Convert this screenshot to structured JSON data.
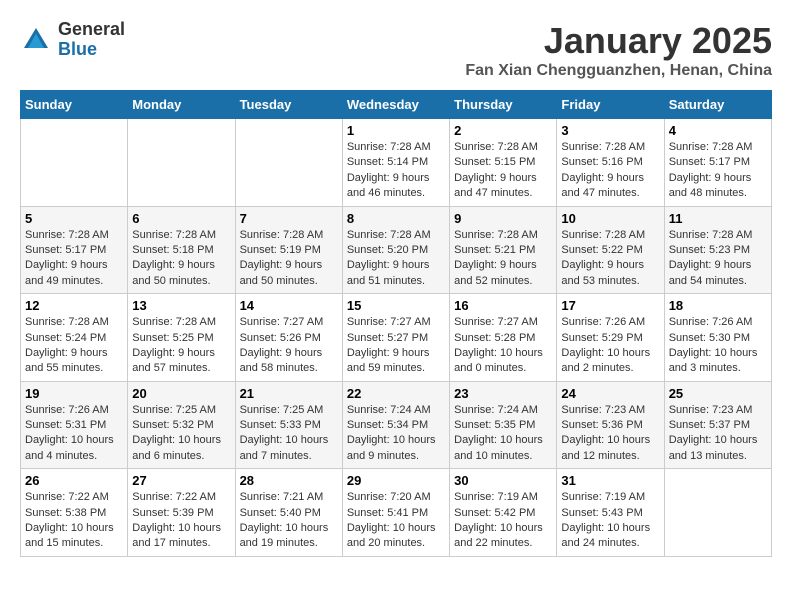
{
  "header": {
    "logo_general": "General",
    "logo_blue": "Blue",
    "title": "January 2025",
    "subtitle": "Fan Xian Chengguanzhen, Henan, China"
  },
  "days_of_week": [
    "Sunday",
    "Monday",
    "Tuesday",
    "Wednesday",
    "Thursday",
    "Friday",
    "Saturday"
  ],
  "weeks": [
    {
      "days": [
        {
          "number": "",
          "content": ""
        },
        {
          "number": "",
          "content": ""
        },
        {
          "number": "",
          "content": ""
        },
        {
          "number": "1",
          "content": "Sunrise: 7:28 AM\nSunset: 5:14 PM\nDaylight: 9 hours\nand 46 minutes."
        },
        {
          "number": "2",
          "content": "Sunrise: 7:28 AM\nSunset: 5:15 PM\nDaylight: 9 hours\nand 47 minutes."
        },
        {
          "number": "3",
          "content": "Sunrise: 7:28 AM\nSunset: 5:16 PM\nDaylight: 9 hours\nand 47 minutes."
        },
        {
          "number": "4",
          "content": "Sunrise: 7:28 AM\nSunset: 5:17 PM\nDaylight: 9 hours\nand 48 minutes."
        }
      ]
    },
    {
      "days": [
        {
          "number": "5",
          "content": "Sunrise: 7:28 AM\nSunset: 5:17 PM\nDaylight: 9 hours\nand 49 minutes."
        },
        {
          "number": "6",
          "content": "Sunrise: 7:28 AM\nSunset: 5:18 PM\nDaylight: 9 hours\nand 50 minutes."
        },
        {
          "number": "7",
          "content": "Sunrise: 7:28 AM\nSunset: 5:19 PM\nDaylight: 9 hours\nand 50 minutes."
        },
        {
          "number": "8",
          "content": "Sunrise: 7:28 AM\nSunset: 5:20 PM\nDaylight: 9 hours\nand 51 minutes."
        },
        {
          "number": "9",
          "content": "Sunrise: 7:28 AM\nSunset: 5:21 PM\nDaylight: 9 hours\nand 52 minutes."
        },
        {
          "number": "10",
          "content": "Sunrise: 7:28 AM\nSunset: 5:22 PM\nDaylight: 9 hours\nand 53 minutes."
        },
        {
          "number": "11",
          "content": "Sunrise: 7:28 AM\nSunset: 5:23 PM\nDaylight: 9 hours\nand 54 minutes."
        }
      ]
    },
    {
      "days": [
        {
          "number": "12",
          "content": "Sunrise: 7:28 AM\nSunset: 5:24 PM\nDaylight: 9 hours\nand 55 minutes."
        },
        {
          "number": "13",
          "content": "Sunrise: 7:28 AM\nSunset: 5:25 PM\nDaylight: 9 hours\nand 57 minutes."
        },
        {
          "number": "14",
          "content": "Sunrise: 7:27 AM\nSunset: 5:26 PM\nDaylight: 9 hours\nand 58 minutes."
        },
        {
          "number": "15",
          "content": "Sunrise: 7:27 AM\nSunset: 5:27 PM\nDaylight: 9 hours\nand 59 minutes."
        },
        {
          "number": "16",
          "content": "Sunrise: 7:27 AM\nSunset: 5:28 PM\nDaylight: 10 hours\nand 0 minutes."
        },
        {
          "number": "17",
          "content": "Sunrise: 7:26 AM\nSunset: 5:29 PM\nDaylight: 10 hours\nand 2 minutes."
        },
        {
          "number": "18",
          "content": "Sunrise: 7:26 AM\nSunset: 5:30 PM\nDaylight: 10 hours\nand 3 minutes."
        }
      ]
    },
    {
      "days": [
        {
          "number": "19",
          "content": "Sunrise: 7:26 AM\nSunset: 5:31 PM\nDaylight: 10 hours\nand 4 minutes."
        },
        {
          "number": "20",
          "content": "Sunrise: 7:25 AM\nSunset: 5:32 PM\nDaylight: 10 hours\nand 6 minutes."
        },
        {
          "number": "21",
          "content": "Sunrise: 7:25 AM\nSunset: 5:33 PM\nDaylight: 10 hours\nand 7 minutes."
        },
        {
          "number": "22",
          "content": "Sunrise: 7:24 AM\nSunset: 5:34 PM\nDaylight: 10 hours\nand 9 minutes."
        },
        {
          "number": "23",
          "content": "Sunrise: 7:24 AM\nSunset: 5:35 PM\nDaylight: 10 hours\nand 10 minutes."
        },
        {
          "number": "24",
          "content": "Sunrise: 7:23 AM\nSunset: 5:36 PM\nDaylight: 10 hours\nand 12 minutes."
        },
        {
          "number": "25",
          "content": "Sunrise: 7:23 AM\nSunset: 5:37 PM\nDaylight: 10 hours\nand 13 minutes."
        }
      ]
    },
    {
      "days": [
        {
          "number": "26",
          "content": "Sunrise: 7:22 AM\nSunset: 5:38 PM\nDaylight: 10 hours\nand 15 minutes."
        },
        {
          "number": "27",
          "content": "Sunrise: 7:22 AM\nSunset: 5:39 PM\nDaylight: 10 hours\nand 17 minutes."
        },
        {
          "number": "28",
          "content": "Sunrise: 7:21 AM\nSunset: 5:40 PM\nDaylight: 10 hours\nand 19 minutes."
        },
        {
          "number": "29",
          "content": "Sunrise: 7:20 AM\nSunset: 5:41 PM\nDaylight: 10 hours\nand 20 minutes."
        },
        {
          "number": "30",
          "content": "Sunrise: 7:19 AM\nSunset: 5:42 PM\nDaylight: 10 hours\nand 22 minutes."
        },
        {
          "number": "31",
          "content": "Sunrise: 7:19 AM\nSunset: 5:43 PM\nDaylight: 10 hours\nand 24 minutes."
        },
        {
          "number": "",
          "content": ""
        }
      ]
    }
  ]
}
